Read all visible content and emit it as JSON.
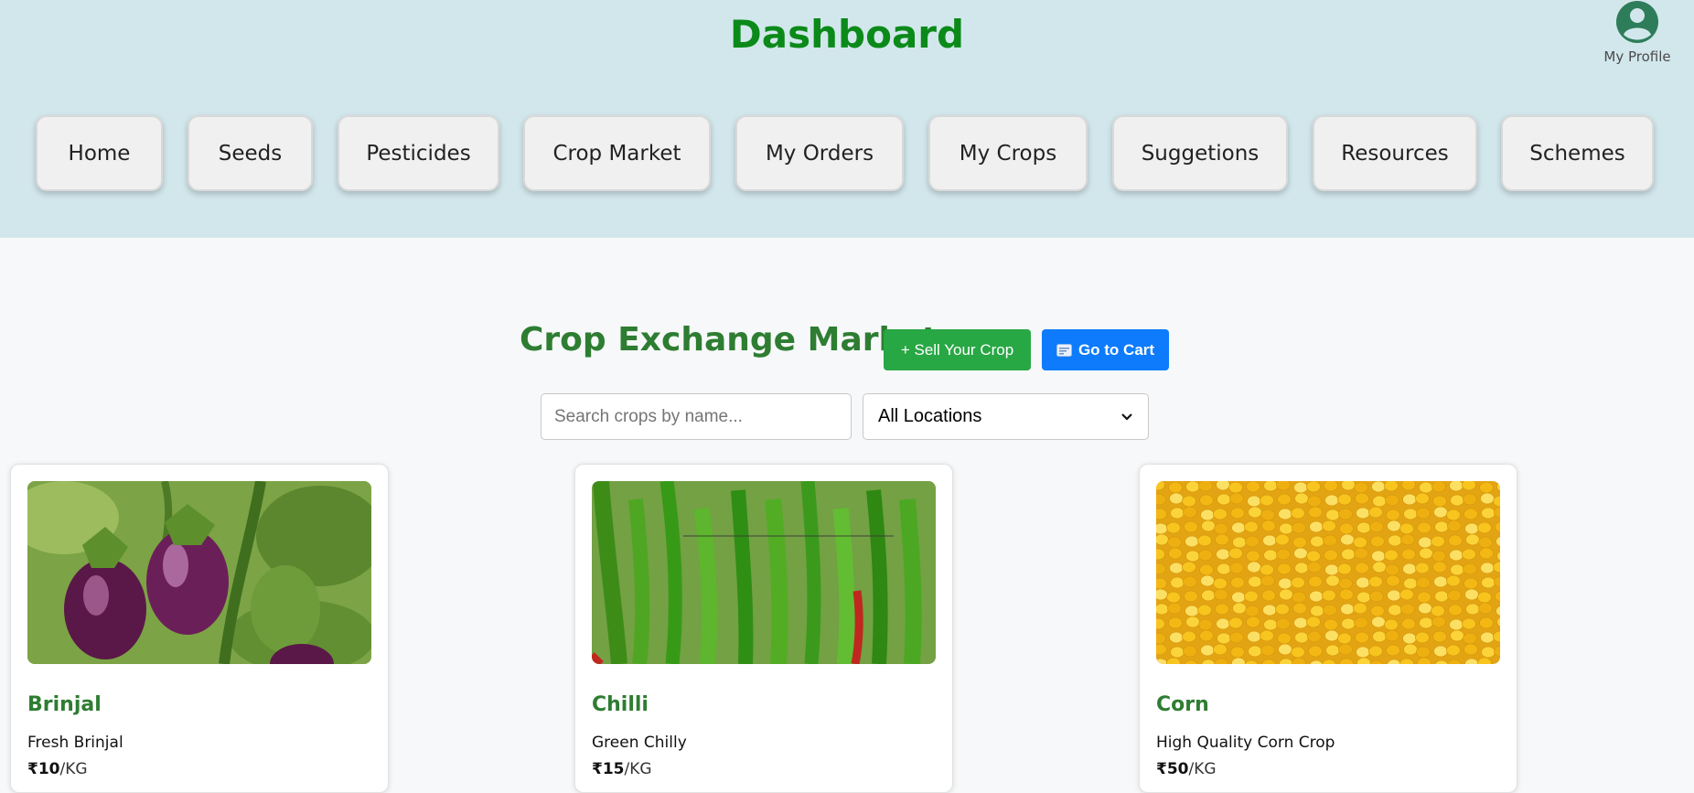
{
  "header": {
    "title": "Dashboard",
    "profile_label": "My Profile",
    "nav": [
      {
        "label": "Home"
      },
      {
        "label": "Seeds"
      },
      {
        "label": "Pesticides"
      },
      {
        "label": "Crop Market"
      },
      {
        "label": "My Orders"
      },
      {
        "label": "My Crops"
      },
      {
        "label": "Suggetions"
      },
      {
        "label": "Resources"
      },
      {
        "label": "Schemes"
      }
    ]
  },
  "market": {
    "title": "Crop Exchange Market",
    "sell_label": "+ Sell Your Crop",
    "cart_label": "Go to Cart",
    "cart_icon": "cart-icon",
    "search_placeholder": "Search crops by name...",
    "search_value": "",
    "location_selected": "All Locations"
  },
  "cards": [
    {
      "name": "Brinjal",
      "description": "Fresh Brinjal",
      "price": "₹10",
      "unit": "/KG",
      "image": "brinjal-photo"
    },
    {
      "name": "Chilli",
      "description": "Green Chilly",
      "price": "₹15",
      "unit": "/KG",
      "image": "chilli-photo"
    },
    {
      "name": "Corn",
      "description": "High Quality Corn Crop",
      "price": "₹50",
      "unit": "/KG",
      "image": "corn-photo"
    }
  ],
  "colors": {
    "header_bg": "#d2e7ec",
    "title_green": "#0b8a1a",
    "accent_green": "#2e7d32",
    "sell_green": "#28a745",
    "cart_blue": "#0d7bfb"
  }
}
